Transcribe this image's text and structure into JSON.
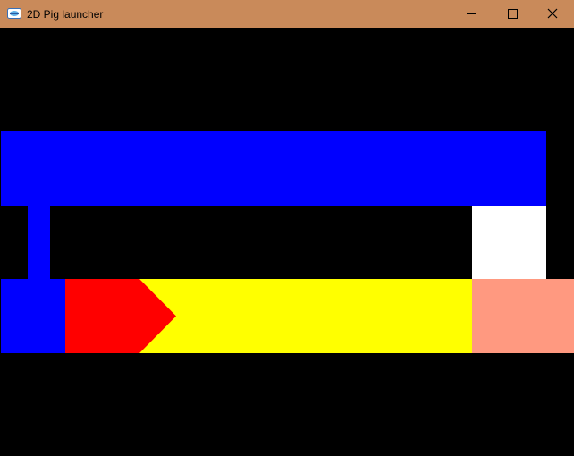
{
  "window": {
    "title": "2D Pig launcher",
    "titlebar_color": "#c98a5a",
    "icon": "app-launcher-icon",
    "controls": {
      "minimize_icon": "minimize-icon",
      "maximize_icon": "maximize-icon",
      "close_icon": "close-icon"
    }
  },
  "game": {
    "background_color": "#000000",
    "colors": {
      "platform": "#0000ff",
      "pig_block": "#ff9980",
      "white_block": "#ffffff",
      "projectile_body": "#ffff00",
      "projectile_tip": "#ff0000",
      "launcher_base": "#0000ff"
    }
  }
}
